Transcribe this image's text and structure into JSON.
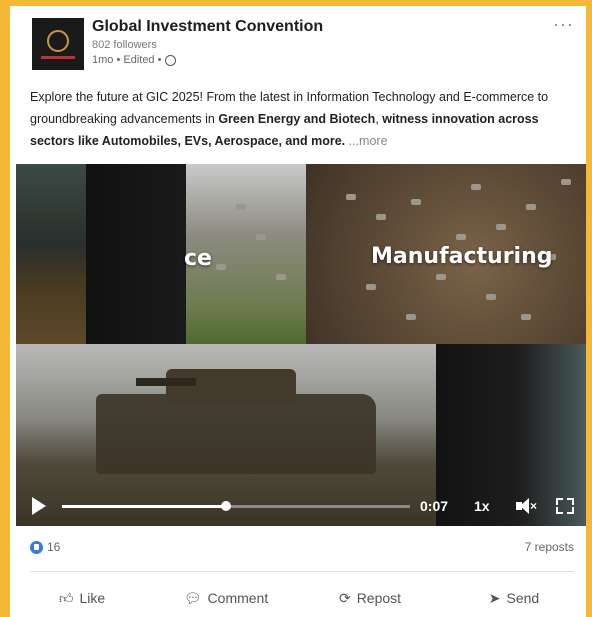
{
  "post": {
    "author": "Global Investment Convention",
    "followers": "802 followers",
    "meta": "1mo • Edited •",
    "text_part1": "Explore the future at GIC 2025! From the latest in Information Technology and E-commerce to groundbreaking advancements in ",
    "text_bold1": "Green Energy and Biotech",
    "text_part2": ", ",
    "text_bold2": "witness innovation across sectors like Automobiles, EVs, Aerospace, and more.",
    "more_label": "...more"
  },
  "video": {
    "overlay_left": "ce",
    "overlay_right": "Manufacturing",
    "time": "0:07",
    "speed": "1x",
    "progress": 0.47
  },
  "stats": {
    "reactions": "16",
    "reposts": "7 reposts"
  },
  "actions": {
    "like": "Like",
    "comment": "Comment",
    "repost": "Repost",
    "send": "Send"
  },
  "colors": {
    "frame": "#f2b836",
    "reaction_badge": "#3a7bd5"
  }
}
